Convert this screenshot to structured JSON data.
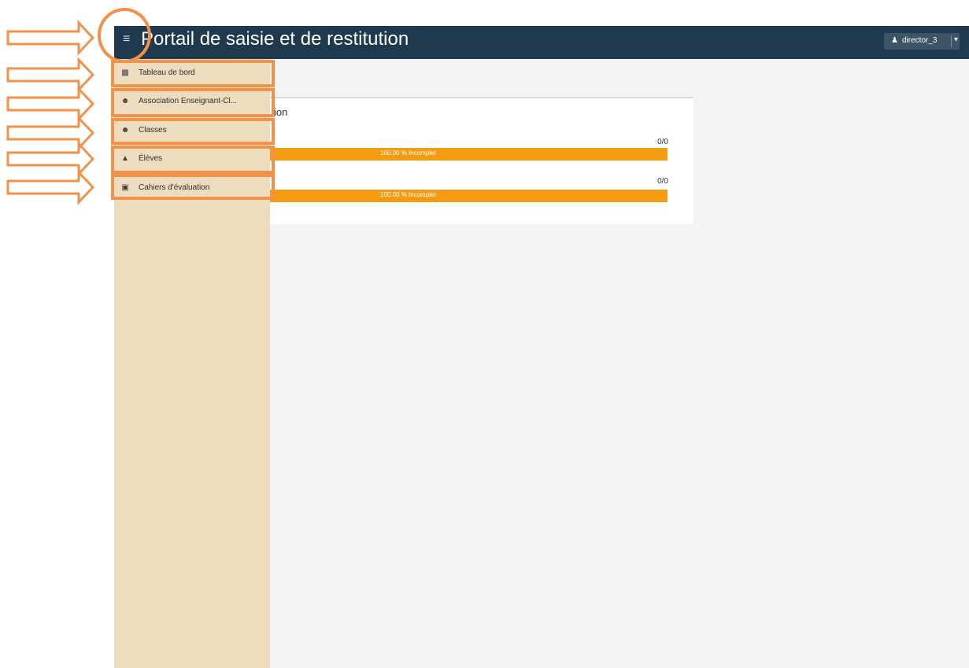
{
  "header": {
    "menu_icon": "hamburger-icon",
    "title": "Portail de saisie et de restitution",
    "user": {
      "icon": "user-icon",
      "name": "director_3"
    }
  },
  "sidebar": {
    "items": [
      {
        "label": "Tableau de bord",
        "icon": "dashboard-icon"
      },
      {
        "label": "Association Enseignant-Cl...",
        "icon": "users-icon"
      },
      {
        "label": "Classes",
        "icon": "users-icon"
      },
      {
        "label": "Élèves",
        "icon": "graduation-cap-icon"
      },
      {
        "label": "Cahiers d'évaluation",
        "icon": "document-icon"
      }
    ]
  },
  "main": {
    "card": {
      "title_fragment": "ion",
      "rows": [
        {
          "count": "0/0",
          "progress_label": "100.00 % Incomplet",
          "progress": 1.0
        },
        {
          "count": "0/0",
          "progress_label": "100.00 % Incomplet",
          "progress": 1.0
        }
      ]
    }
  },
  "annotation": {
    "color": "#f0924a"
  }
}
